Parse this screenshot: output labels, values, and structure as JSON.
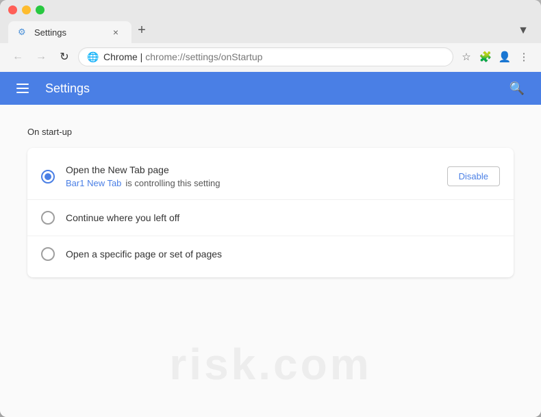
{
  "browser": {
    "tab": {
      "favicon": "⚙",
      "title": "Settings",
      "close_label": "×"
    },
    "new_tab_label": "+",
    "tab_extras_label": "▼",
    "nav": {
      "back_label": "←",
      "forward_label": "→",
      "reload_label": "↻"
    },
    "url_bar": {
      "security_icon": "🌐",
      "domain": "Chrome",
      "separator": " | ",
      "path_prefix": "chrome://settings/",
      "path": "onStartup"
    },
    "url_actions": {
      "bookmark_label": "☆",
      "extensions_label": "🧩",
      "profile_label": "👤",
      "menu_label": "⋮"
    }
  },
  "settings": {
    "header": {
      "menu_label": "☰",
      "title": "Settings",
      "search_label": "🔍"
    },
    "page": {
      "section_title": "On start-up",
      "options": [
        {
          "id": "new-tab",
          "label": "Open the New Tab page",
          "checked": true,
          "has_sub": true,
          "sub_link": "Bar1 New Tab",
          "sub_text": " is controlling this setting",
          "has_disable": true,
          "disable_label": "Disable"
        },
        {
          "id": "continue",
          "label": "Continue where you left off",
          "checked": false,
          "has_sub": false
        },
        {
          "id": "specific",
          "label": "Open a specific page or set of pages",
          "checked": false,
          "has_sub": false
        }
      ]
    }
  },
  "watermark": {
    "text": "risk.com"
  }
}
